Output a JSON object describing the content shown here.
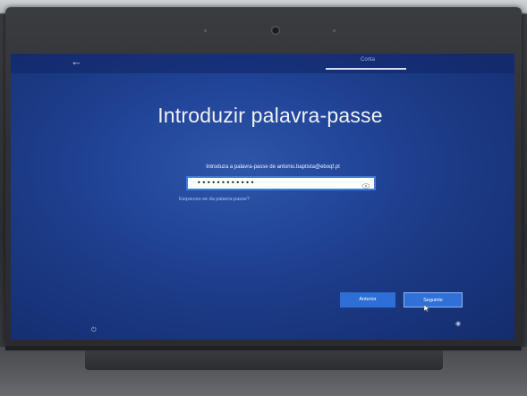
{
  "screen": {
    "top_tab": "Conta",
    "title": "Introduzir palavra-passe",
    "prompt": "Introduza a palavra-passe de antonio.baptista@eboqf.pt",
    "password_value": "••••••••••••",
    "forgot_link": "Esqueceu-se da palavra-passe?",
    "back_button": "Anterior",
    "next_button": "Seguinte",
    "icons": {
      "back": "back-arrow-icon",
      "reveal": "eye-icon",
      "power": "power-icon",
      "accessibility": "accessibility-icon"
    },
    "colors": {
      "background": "#22469a",
      "button": "#2d6fd6",
      "field_border": "#3f7bd6",
      "link": "#a9c7f5"
    }
  }
}
